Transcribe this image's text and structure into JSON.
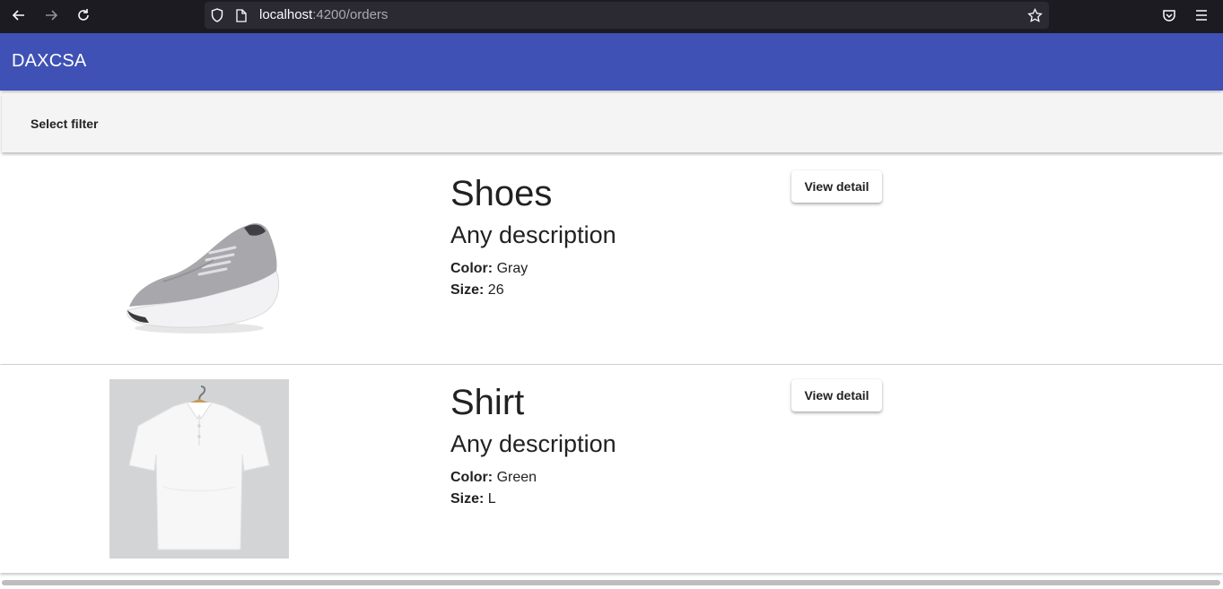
{
  "browser": {
    "url_host": "localhost",
    "url_path": ":4200/orders"
  },
  "app": {
    "title": "DAXCSA"
  },
  "filter": {
    "label": "Select filter"
  },
  "orders": [
    {
      "title": "Shoes",
      "description": "Any description",
      "color_label": "Color:",
      "color_value": "Gray",
      "size_label": "Size:",
      "size_value": "26",
      "button_label": "View detail",
      "image_icon": "sneaker-image"
    },
    {
      "title": "Shirt",
      "description": "Any description",
      "color_label": "Color:",
      "color_value": "Green",
      "size_label": "Size:",
      "size_value": "L",
      "button_label": "View detail",
      "image_icon": "polo-shirt-image"
    }
  ],
  "colors": {
    "toolbar": "#3f51b5",
    "browser_chrome": "#1c1b22",
    "url_bar": "#2b2a33"
  }
}
